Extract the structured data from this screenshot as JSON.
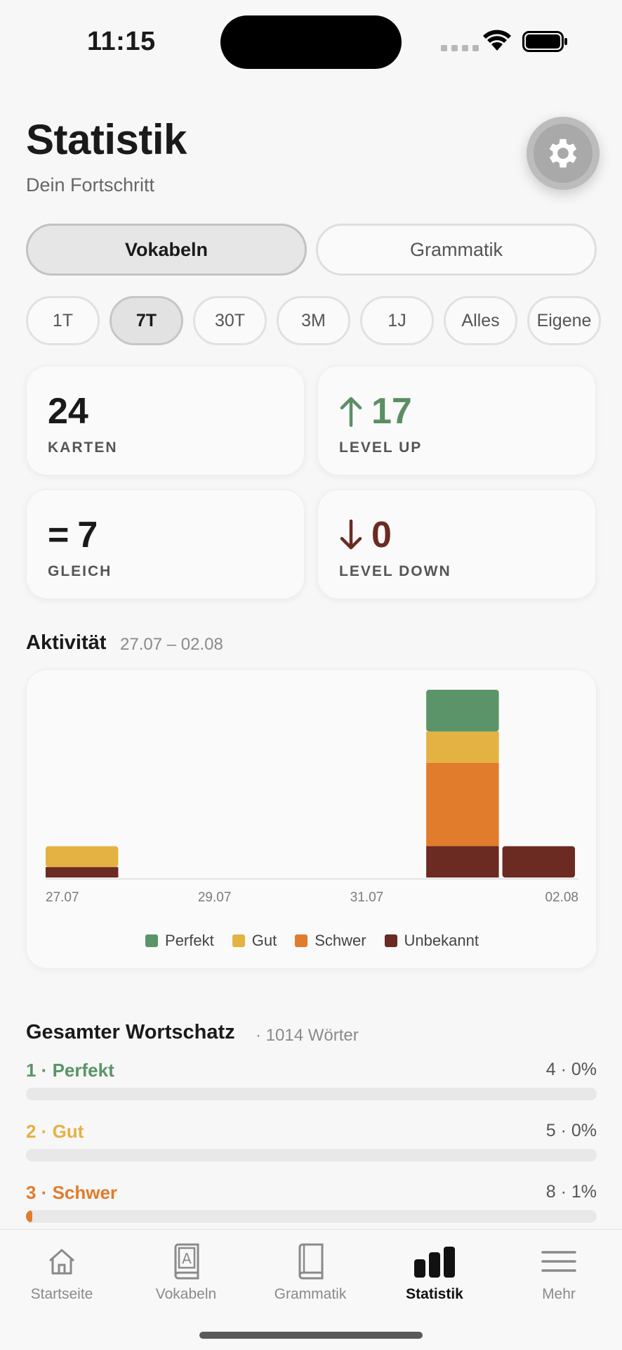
{
  "status_bar": {
    "time": "11:15"
  },
  "header": {
    "title": "Statistik",
    "subtitle": "Dein Fortschritt"
  },
  "segments": [
    {
      "label": "Vokabeln",
      "active": true
    },
    {
      "label": "Grammatik",
      "active": false
    }
  ],
  "ranges": [
    {
      "label": "1T",
      "active": false
    },
    {
      "label": "7T",
      "active": true
    },
    {
      "label": "30T",
      "active": false
    },
    {
      "label": "3M",
      "active": false
    },
    {
      "label": "1J",
      "active": false
    },
    {
      "label": "Alles",
      "active": false
    },
    {
      "label": "Eigene",
      "active": false
    }
  ],
  "stats": [
    {
      "symbol": "",
      "value": "24",
      "label": "KARTEN",
      "color": "#1a1a1a"
    },
    {
      "symbol": "↑",
      "value": "17",
      "label": "LEVEL UP",
      "color": "#5b8f63"
    },
    {
      "symbol": "=",
      "value": "7",
      "label": "GLEICH",
      "color": "#1a1a1a"
    },
    {
      "symbol": "↓",
      "value": "0",
      "label": "LEVEL DOWN",
      "color": "#6b2a22"
    }
  ],
  "activity": {
    "title": "Aktivität",
    "range": "27.07 – 02.08"
  },
  "chart_data": {
    "type": "bar",
    "stacked": true,
    "categories": [
      "27.07",
      "28.07",
      "29.07",
      "30.07",
      "31.07",
      "01.08",
      "02.08"
    ],
    "x_tick_labels": [
      "27.07",
      "29.07",
      "31.07",
      "02.08"
    ],
    "series": [
      {
        "name": "Unbekannt",
        "color": "#6b2a22",
        "values": [
          1,
          0,
          0,
          0,
          0,
          3,
          3
        ]
      },
      {
        "name": "Schwer",
        "color": "#e07c2c",
        "values": [
          0,
          0,
          0,
          0,
          0,
          8,
          0
        ]
      },
      {
        "name": "Gut",
        "color": "#e3b242",
        "values": [
          2,
          0,
          0,
          0,
          0,
          3,
          0
        ]
      },
      {
        "name": "Perfekt",
        "color": "#5b9468",
        "values": [
          0,
          0,
          0,
          0,
          0,
          4,
          0
        ]
      }
    ],
    "legend_order": [
      "Perfekt",
      "Gut",
      "Schwer",
      "Unbekannt"
    ],
    "ylim": [
      0,
      18
    ],
    "legend_position": "bottom-center",
    "grid": false
  },
  "vocabulary": {
    "title": "Gesamter Wortschatz",
    "count": "· 1014 Wörter",
    "levels": [
      {
        "name": "1 · Perfekt",
        "stat": "4 · 0%",
        "fraction": 0.0,
        "color": "#5b9468"
      },
      {
        "name": "2 · Gut",
        "stat": "5 · 0%",
        "fraction": 0.0,
        "color": "#e3b242"
      },
      {
        "name": "3 · Schwer",
        "stat": "8 · 1%",
        "fraction": 0.008,
        "color": "#e07c2c"
      }
    ]
  },
  "tabs": [
    {
      "label": "Startseite",
      "icon": "home-icon",
      "active": false
    },
    {
      "label": "Vokabeln",
      "icon": "vocab-book-icon",
      "active": false
    },
    {
      "label": "Grammatik",
      "icon": "book-icon",
      "active": false
    },
    {
      "label": "Statistik",
      "icon": "bar-chart-icon",
      "active": true
    },
    {
      "label": "Mehr",
      "icon": "menu-icon",
      "active": false
    }
  ]
}
